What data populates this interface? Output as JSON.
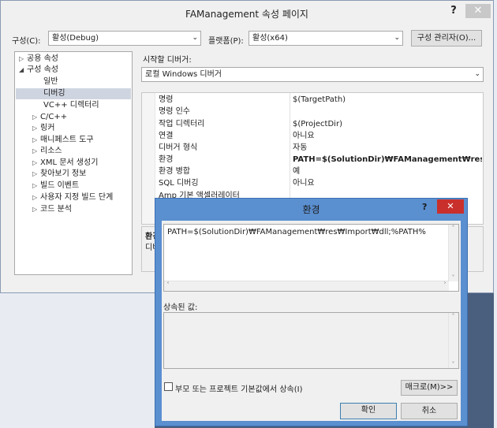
{
  "window": {
    "title": "FAManagement 속성 페이지",
    "help_glyph": "?",
    "close_glyph": "✕"
  },
  "toolbar": {
    "config_label": "구성(C):",
    "config_value": "활성(Debug)",
    "platform_label": "플랫폼(P):",
    "platform_value": "활성(x64)",
    "config_manager_button": "구성 관리자(O)..."
  },
  "tree": {
    "items": [
      {
        "glyph": "▷",
        "label": "공용 속성"
      },
      {
        "glyph": "◢",
        "label": "구성 속성"
      },
      {
        "glyph": "",
        "label": "일반"
      },
      {
        "glyph": "",
        "label": "디버깅"
      },
      {
        "glyph": "",
        "label": "VC++ 디렉터리"
      },
      {
        "glyph": "▷",
        "label": "C/C++"
      },
      {
        "glyph": "▷",
        "label": "링커"
      },
      {
        "glyph": "▷",
        "label": "매니페스트 도구"
      },
      {
        "glyph": "▷",
        "label": "리소스"
      },
      {
        "glyph": "▷",
        "label": "XML 문서 생성기"
      },
      {
        "glyph": "▷",
        "label": "찾아보기 정보"
      },
      {
        "glyph": "▷",
        "label": "빌드 이벤트"
      },
      {
        "glyph": "▷",
        "label": "사용자 지정 빌드 단계"
      },
      {
        "glyph": "▷",
        "label": "코드 분석"
      }
    ]
  },
  "debugger": {
    "label": "시작할 디버거:",
    "value": "로컬 Windows 디버거"
  },
  "grid": {
    "rows": [
      {
        "name": "명령",
        "value": "$(TargetPath)"
      },
      {
        "name": "명령 인수",
        "value": ""
      },
      {
        "name": "작업 디렉터리",
        "value": "$(ProjectDir)"
      },
      {
        "name": "연결",
        "value": "아니요"
      },
      {
        "name": "디버거 형식",
        "value": "자동"
      },
      {
        "name": "환경",
        "value": "PATH=$(SolutionDir)₩FAManagement₩res₩Import"
      },
      {
        "name": "환경 병합",
        "value": "예"
      },
      {
        "name": "SQL 디버깅",
        "value": "아니요"
      },
      {
        "name": "Amp 기본 액셀러레이터",
        "value": ""
      }
    ]
  },
  "description": {
    "title": "환경",
    "text": "디버"
  },
  "dialog": {
    "title": "환경",
    "help_glyph": "?",
    "close_glyph": "✕",
    "env_value": "PATH=$(SolutionDir)₩FAManagement₩res₩Import₩dll;%PATH%",
    "inherited_label": "상속된 값:",
    "inherit_checkbox_label": "부모 또는 프로젝트 기본값에서 상속(I)",
    "macro_button": "매크로(M)>>",
    "ok_button": "확인",
    "cancel_button": "취소"
  }
}
